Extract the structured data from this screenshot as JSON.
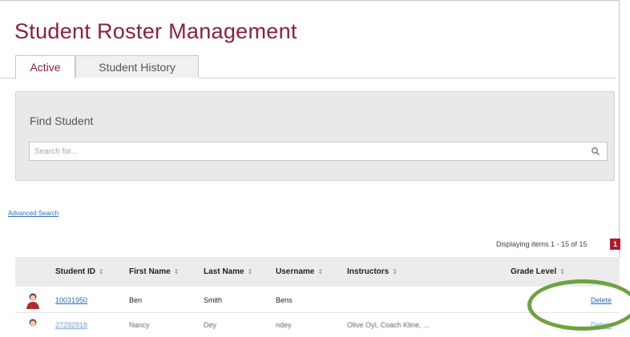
{
  "page": {
    "title": "Student Roster Management"
  },
  "tabs": [
    {
      "label": "Active",
      "active": true
    },
    {
      "label": "Student History",
      "active": false
    }
  ],
  "find": {
    "label": "Find Student",
    "placeholder": "Search for...",
    "icon": "search-icon"
  },
  "advanced_search": "Advanced Search",
  "paging": {
    "text": "Displaying items 1 - 15 of 15",
    "current_page": "1"
  },
  "table": {
    "columns": [
      {
        "label": "Student ID",
        "sort_icon": "⇕"
      },
      {
        "label": "First Name",
        "sort_icon": "⇕"
      },
      {
        "label": "Last Name",
        "sort_icon": "⇕"
      },
      {
        "label": "Username",
        "sort_icon": "⇕"
      },
      {
        "label": "Instructors",
        "sort_icon": "⇕"
      },
      {
        "label": "Grade Level",
        "sort_icon": "⇕"
      }
    ],
    "rows": [
      {
        "student_id": "10031950",
        "first_name": "Ben",
        "last_name": "Smith",
        "username": "Bens",
        "instructors": "",
        "grade_level": "",
        "action": "Delete"
      },
      {
        "student_id": "27292918",
        "first_name": "Nancy",
        "last_name": "Dey",
        "username": "ndey",
        "instructors": "Olive Oyl, Coach Kline, ...",
        "grade_level": "",
        "action": "Delete"
      }
    ]
  },
  "colors": {
    "title": "#8d1f3a",
    "link": "#2a6ebb",
    "page_badge": "#b0182a",
    "highlight": "#6ea23f"
  }
}
